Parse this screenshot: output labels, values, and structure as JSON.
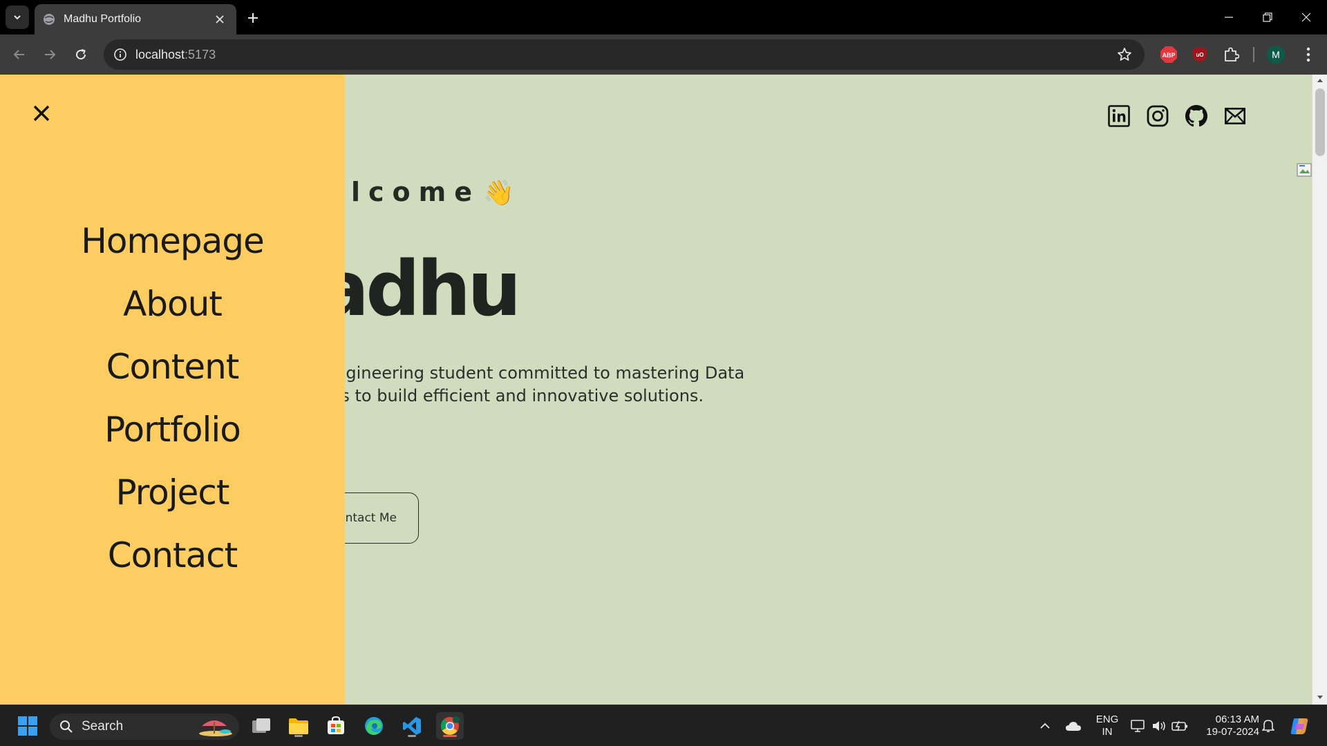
{
  "browser": {
    "tab_title": "Madhu Portfolio",
    "url_host": "localhost",
    "url_port": ":5173",
    "profile_initial": "M",
    "extensions": [
      "ABP",
      "uO"
    ]
  },
  "page": {
    "welcome": "lcome",
    "name": "adhu",
    "intro_line1": "Engineering student committed to mastering Data",
    "intro_line2": "ms to build efficient and innovative solutions.",
    "contact_button": "Contact Me",
    "social_icons": [
      "linkedin-icon",
      "instagram-icon",
      "github-icon",
      "mail-icon"
    ]
  },
  "menu": {
    "items": [
      "Homepage",
      "About",
      "Content",
      "Portfolio",
      "Project",
      "Contact"
    ]
  },
  "taskbar": {
    "search_label": "Search",
    "lang_line1": "ENG",
    "lang_line2": "IN",
    "time": "06:13 AM",
    "date": "19-07-2024"
  },
  "colors": {
    "page_bg": "#cfdcbd",
    "menu_bg": "#fdcd62",
    "text_dark": "#202420"
  }
}
